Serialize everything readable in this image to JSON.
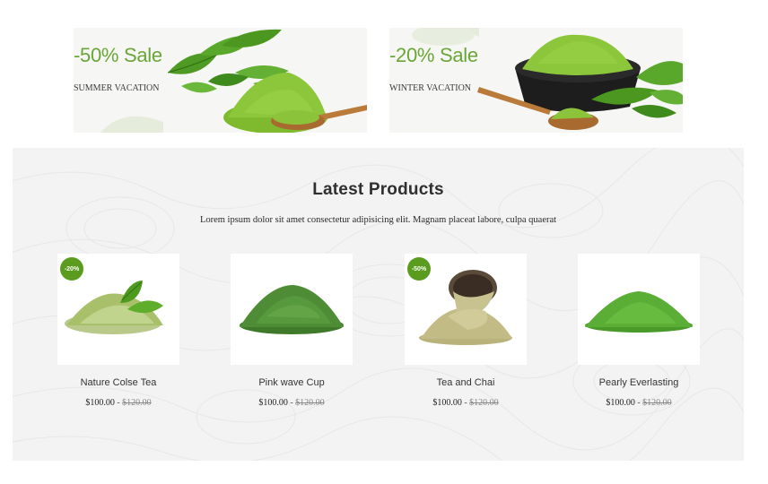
{
  "banners": [
    {
      "title": "-50% Sale",
      "subtitle": "SUMMER VACATION"
    },
    {
      "title": "-20% Sale",
      "subtitle": "WINTER VACATION"
    }
  ],
  "latest": {
    "title": "Latest Products",
    "description": "Lorem ipsum dolor sit amet consectetur adipisicing elit. Magnam placeat labore, culpa quaerat"
  },
  "products": [
    {
      "name": "Nature Colse Tea",
      "price": "$100.00",
      "separator": "-",
      "old_price": "$120.00",
      "badge": "-20%"
    },
    {
      "name": "Pink wave Cup",
      "price": "$100.00",
      "separator": "-",
      "old_price": "$120.00",
      "badge": ""
    },
    {
      "name": "Tea and Chai",
      "price": "$100.00",
      "separator": "-",
      "old_price": "$120.00",
      "badge": "-50%"
    },
    {
      "name": "Pearly Everlasting",
      "price": "$100.00",
      "separator": "-",
      "old_price": "$120.00",
      "badge": ""
    }
  ],
  "colors": {
    "accent_green": "#6aa637",
    "badge_green": "#5a9c1e",
    "section_bg": "#f3f3f3"
  }
}
